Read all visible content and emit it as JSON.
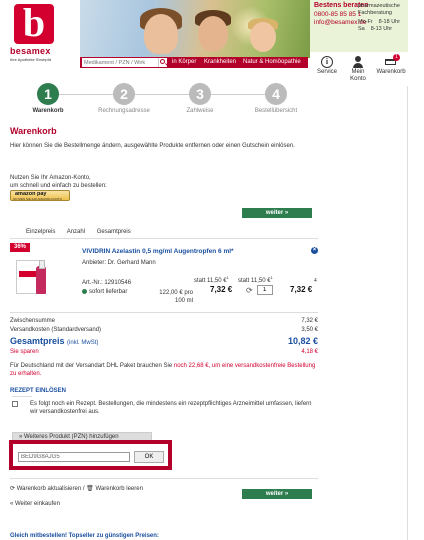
{
  "header": {
    "logo_letter": "b",
    "logo_name": "besamex",
    "logo_tagline": "Ihre Apotheke Strohpfd",
    "contact_title": "Bestens beraten",
    "contact_side": "pharmazeutische Fachberatung",
    "phone": "0800-85 85 85 1",
    "email": "info@besamex.de",
    "hours": [
      {
        "days": "Mo-Fr",
        "time": "8-18 Uhr"
      },
      {
        "days": "Sa",
        "time": "8-13 Uhr"
      }
    ],
    "search_placeholder": "Medikament / PZN / Wirk",
    "nav": [
      "in Körper",
      "Krankheiten",
      "Natur & Homöopathie"
    ],
    "tools": [
      {
        "label": "Service",
        "icon": "info-icon"
      },
      {
        "label": "Mein Konto",
        "icon": "account-icon"
      },
      {
        "label": "Warenkorb",
        "icon": "cart-icon",
        "badge": "1"
      }
    ]
  },
  "steps": [
    {
      "num": "1",
      "label": "Warenkorb",
      "active": true
    },
    {
      "num": "2",
      "label": "Rechnungsadresse",
      "active": false
    },
    {
      "num": "3",
      "label": "Zahlweise",
      "active": false
    },
    {
      "num": "4",
      "label": "Bestellübersicht",
      "active": false
    }
  ],
  "cart": {
    "title": "Warenkorb",
    "intro": "Hier können Sie die Bestellmenge ändern, ausgewählte Produkte entfernen oder einen Gutschein einlösen.",
    "amazon_text_1": "Nutzen Sie Ihr Amazon-Konto,",
    "amazon_text_2": "um schnell und einfach zu bestellen:",
    "amazon_btn": "amazon pay",
    "amazon_btn_sub": "NUTZEN SIE IHR AMAZON-KONTO",
    "weiter_label": "weiter »",
    "columns": [
      "Einzelpreis",
      "Anzahl",
      "Gesamtpreis"
    ]
  },
  "product": {
    "discount": "36%",
    "name": "VIVIDRIN Azelastin 0,5 mg/ml Augentropfen 6 ml*",
    "maker": "Anbieter: Dr. Gerhard Mann",
    "art_nr": "Art.-Nr.: 12910546",
    "availability": "sofort lieferbar",
    "base_price": "122,00 € pro 100 ml",
    "unit_statt": "statt 11,50 €",
    "unit_statt_sup": "1",
    "unit_price": "7,32 €",
    "total_statt": "statt 11,50 €",
    "total_statt_sup": "1",
    "total_price": "7,32 €",
    "quantity": "1",
    "footnote": "4"
  },
  "totals": {
    "subtotal_label": "Zwischensumme",
    "subtotal_value": "7,32 €",
    "shipping_label": "Versandkosten (Standardversand)",
    "shipping_value": "3,50 €",
    "total_label": "Gesamtpreis",
    "total_incl": "(inkl. MwSt)",
    "total_value": "10,82 €",
    "savings_label": "Sie sparen",
    "savings_value": "4,18 €",
    "dhl_text_1": "Für Deutschland mit der Versandart DHL Paket brauchen Sie",
    "dhl_text_red": "noch 22,68 €, um eine versandkostenfreie Bestellung zu erhalten."
  },
  "rezept": {
    "heading": "Rezept einlösen",
    "text": "Es folgt noch ein Rezept. Bestellungen, die mindestens ein rezeptpflichtiges Arzneimittel umfassen, liefern wir versandkostenfrei aus."
  },
  "voucher": {
    "pzn_button": "» Weiteres Produkt (PZN) hinzufügen",
    "code": "BED9G8AJG5",
    "ok_label": "OK"
  },
  "footer": {
    "update_label": "Warenkorb aktualisieren / 🗑 Warenkorb leeren",
    "back_label": "« Weiter einkaufen",
    "bottom_heading": "Gleich mitbestellen! Topseller zu günstigen Preisen:"
  },
  "colors": {
    "brand_red": "#b3002a",
    "accent_green": "#2e7d4f",
    "link_blue": "#1a4fa0"
  }
}
